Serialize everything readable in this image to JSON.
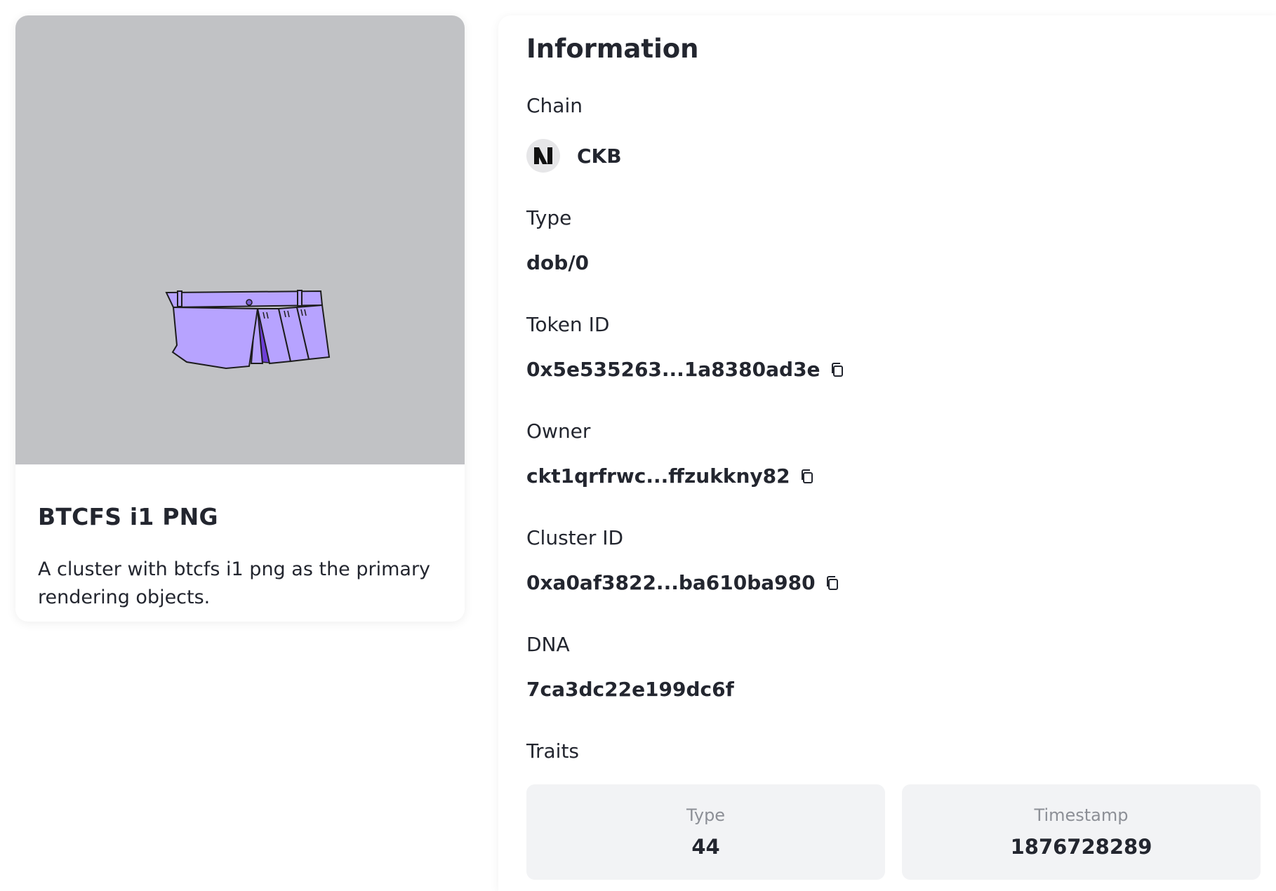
{
  "card": {
    "title": "BTCFS i1 PNG",
    "description": "A cluster with btcfs i1 png as the primary rendering objects.",
    "image_alt": "purple pleated skirt",
    "image_bg": "#c1c2c5",
    "accent_color": "#b7a3ff"
  },
  "info": {
    "title": "Information",
    "chain": {
      "label": "Chain",
      "value": "CKB",
      "icon": "nervos-logo-icon"
    },
    "type": {
      "label": "Type",
      "value": "dob/0"
    },
    "token_id": {
      "label": "Token ID",
      "value": "0x5e535263...1a8380ad3e"
    },
    "owner": {
      "label": "Owner",
      "value": "ckt1qrfrwc...ffzukkny82"
    },
    "cluster_id": {
      "label": "Cluster ID",
      "value": "0xa0af3822...ba610ba980"
    },
    "dna": {
      "label": "DNA",
      "value": "7ca3dc22e199dc6f"
    },
    "traits_label": "Traits",
    "traits": [
      {
        "name": "Type",
        "value": "44"
      },
      {
        "name": "Timestamp",
        "value": "1876728289"
      }
    ]
  }
}
